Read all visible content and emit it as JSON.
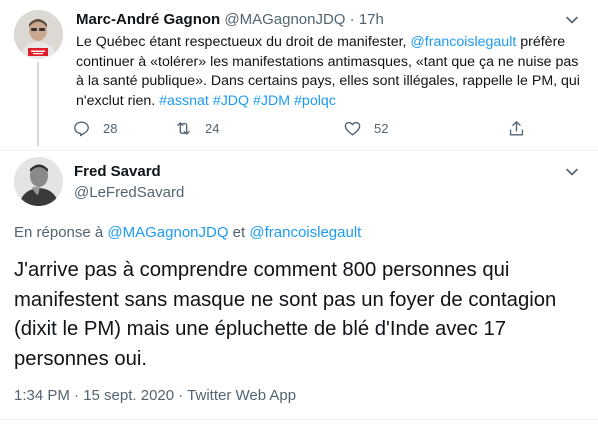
{
  "tweet1": {
    "author_name": "Marc-André Gagnon",
    "handle": "@MAGagnonJDQ",
    "separator": "·",
    "time": "17h",
    "text_segments": [
      {
        "text": "Le Québec étant respectueux du droit de manifester, ",
        "link": false
      },
      {
        "text": "@francoislegault",
        "link": true
      },
      {
        "text": " préfère continuer à «tolérer» les manifestations antimasques, «tant que ça ne nuise pas à la santé publique». Dans certains pays, elles sont illégales, rappelle le PM, qui n'exclut rien. ",
        "link": false
      },
      {
        "text": "#assnat",
        "link": true
      },
      {
        "text": " ",
        "link": false
      },
      {
        "text": "#JDQ",
        "link": true
      },
      {
        "text": " ",
        "link": false
      },
      {
        "text": "#JDM",
        "link": true
      },
      {
        "text": " ",
        "link": false
      },
      {
        "text": "#polqc",
        "link": true
      }
    ],
    "replies": "28",
    "retweets": "24",
    "likes": "52",
    "icons": [
      "avatar",
      "chevron-down-icon",
      "reply-icon",
      "retweet-icon",
      "like-icon",
      "share-icon"
    ]
  },
  "tweet2": {
    "author_name": "Fred Savard",
    "handle": "@LeFredSavard",
    "reply_prefix": "En réponse à ",
    "reply_user1": "@MAGagnonJDQ",
    "reply_and": " et ",
    "reply_user2": "@francoislegault",
    "text": "J'arrive pas à comprendre comment 800 personnes qui manifestent sans masque ne sont pas un foyer de contagion (dixit le PM) mais une épluchette de blé d'Inde avec 17 personnes oui.",
    "timestamp": "1:34 PM · 15 sept. 2020 · Twitter Web App"
  },
  "colors": {
    "link": "#1d9bf0",
    "muted": "#536471",
    "text": "#0f1419",
    "divider": "#eff3f4"
  }
}
